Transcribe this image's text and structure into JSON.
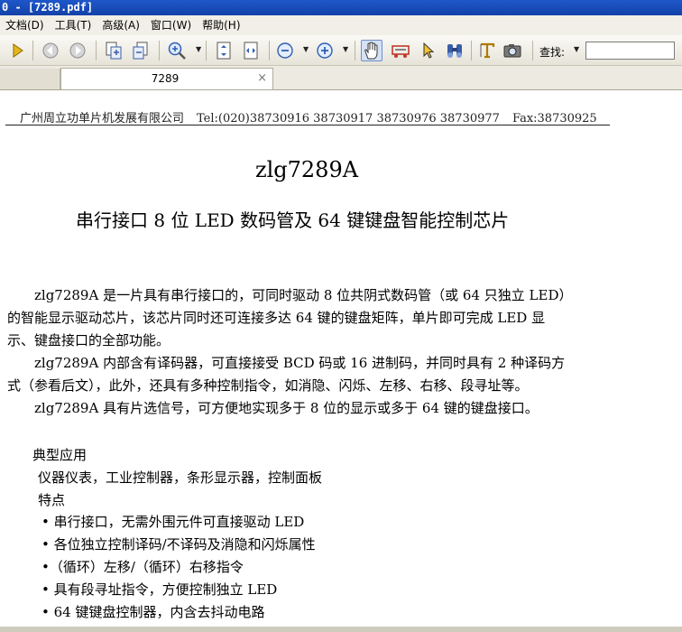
{
  "window": {
    "title": "0 - [7289.pdf]"
  },
  "menu": [
    "文档(D)",
    "工具(T)",
    "高级(A)",
    "窗口(W)",
    "帮助(H)"
  ],
  "toolbar": {
    "find_label": "查找:",
    "find_value": ""
  },
  "tab": {
    "title": "7289",
    "close": "×"
  },
  "doc": {
    "header": {
      "company": "广州周立功单片机发展有限公司",
      "tel": "Tel:(020)38730916 38730917 38730976 38730977",
      "fax": "Fax:38730925"
    },
    "title": "zlg7289A",
    "subtitle": "串行接口 8 位 LED 数码管及 64 键键盘智能控制芯片",
    "para1": [
      "　　zlg7289A 是一片具有串行接口的，可同时驱动 8 位共阴式数码管（或 64 只独立 LED）",
      "的智能显示驱动芯片，该芯片同时还可连接多达 64 键的键盘矩阵，单片即可完成 LED 显",
      "示、键盘接口的全部功能。"
    ],
    "para2": [
      "　　zlg7289A 内部含有译码器，可直接接受 BCD 码或 16 进制码，并同时具有 2 种译码方",
      "式（参看后文），此外，还具有多种控制指令，如消隐、闪烁、左移、右移、段寻址等。"
    ],
    "para3": "　　zlg7289A 具有片选信号，可方便地实现多于 8 位的显示或多于 64 键的键盘接口。",
    "applications_heading": "典型应用",
    "applications": "仪器仪表，工业控制器，条形显示器，控制面板",
    "features_heading": "特点",
    "features": [
      "• 串行接口，无需外围元件可直接驱动 LED",
      "• 各位独立控制译码/不译码及消隐和闪烁属性",
      "•（循环）左移/（循环）右移指令",
      "• 具有段寻址指令，方便控制独立 LED",
      "• 64 键键盘控制器，内含去抖动电路"
    ]
  }
}
